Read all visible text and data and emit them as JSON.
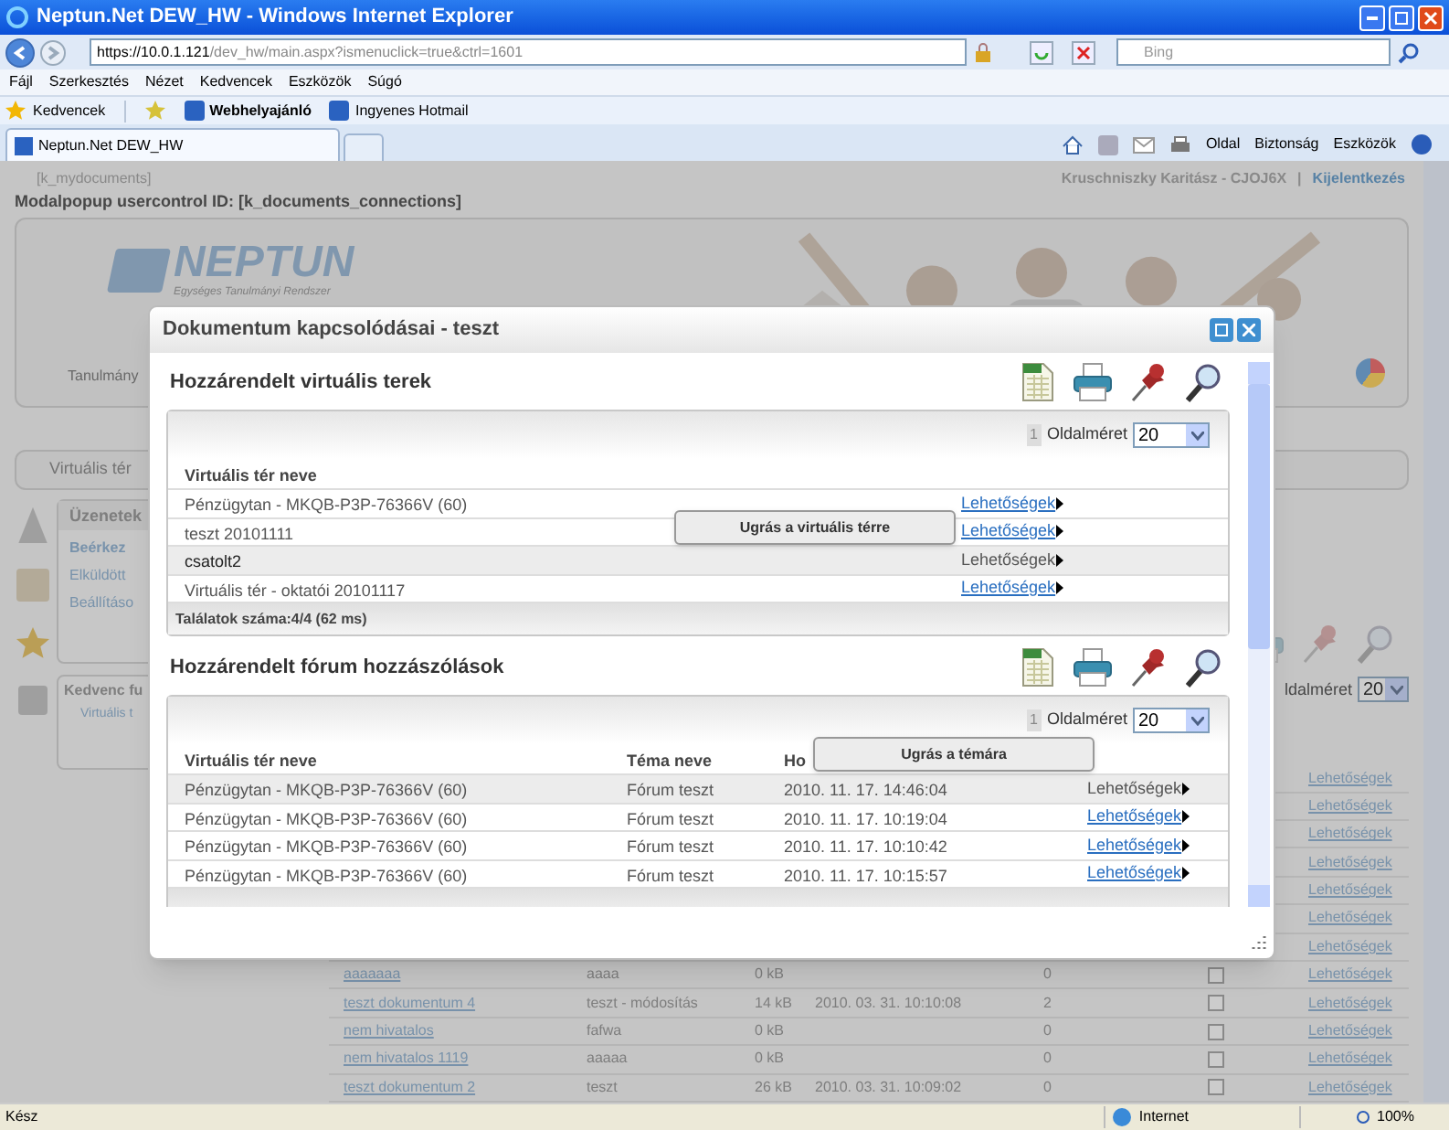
{
  "window": {
    "title": "Neptun.Net DEW_HW - Windows Internet Explorer"
  },
  "address_bar": {
    "url_host": "https://10.0.1.121",
    "url_path": "/dev_hw/main.aspx?ismenuclick=true&ctrl=1601"
  },
  "search": {
    "placeholder": "Bing"
  },
  "menu": [
    "Fájl",
    "Szerkesztés",
    "Nézet",
    "Kedvencek",
    "Eszközök",
    "Súgó"
  ],
  "favorites_bar": {
    "favorites": "Kedvencek",
    "links": [
      {
        "label": "Webhelyajánló",
        "bold": true
      },
      {
        "label": "Ingyenes Hotmail",
        "bold": false
      }
    ]
  },
  "tabs": [
    {
      "label": "Neptun.Net DEW_HW",
      "selected": true
    }
  ],
  "command_bar": [
    "Oldal",
    "Biztonság",
    "Eszközök"
  ],
  "page": {
    "page_id": "[k_mydocuments]",
    "modal_info": "Modalpopup usercontrol ID: [k_documents_connections]",
    "user": "Kruschniszky Karitász - CJOJ6X",
    "separator": "|",
    "logout": "Kijelentkezés",
    "logo": "NEPTUN",
    "logo_subtitle": "Egységes Tanulmányi Rendszer",
    "header_tab": "Tanulmány",
    "nav_tab": "Virtuális tér",
    "messages": {
      "title": "Üzenetek",
      "items": [
        {
          "label": "Beérkez",
          "bold": true
        },
        {
          "label": "Elküldött",
          "bold": false
        },
        {
          "label": "Beállításo",
          "bold": false
        }
      ]
    },
    "favorites": {
      "title": "Kedvenc fu",
      "items": [
        "Virtuális t"
      ]
    },
    "documents": {
      "page_size_label": "ldalméret",
      "page_size": "20",
      "rows": [
        {
          "options": "Lehetőségek"
        },
        {
          "options": "Lehetőségek"
        },
        {
          "options": "Lehetőségek"
        },
        {
          "options": "Lehetőségek"
        },
        {
          "options": "Lehetőségek"
        },
        {
          "options": "Lehetőségek"
        },
        {
          "options": "Lehetőségek"
        },
        {
          "name": "aaaaaaa",
          "description": "aaaa",
          "size": "0 kB",
          "count": "0",
          "checked": false,
          "options": "Lehetőségek"
        },
        {
          "name": "teszt dokumentum 4",
          "description": "teszt - módosítás",
          "size": "14 kB",
          "date": "2010. 03. 31. 10:10:08",
          "count": "2",
          "checked": false,
          "options": "Lehetőségek"
        },
        {
          "name": "nem hivatalos",
          "description": "fafwa",
          "size": "0 kB",
          "count": "0",
          "checked": false,
          "options": "Lehetőségek"
        },
        {
          "name": "nem hivatalos 1119",
          "description": "aaaaa",
          "size": "0 kB",
          "count": "0",
          "checked": false,
          "options": "Lehetőségek"
        },
        {
          "name": "teszt dokumentum 2",
          "description": "teszt",
          "size": "26 kB",
          "date": "2010. 03. 31. 10:09:02",
          "count": "0",
          "checked": false,
          "options": "Lehetőségek"
        }
      ]
    }
  },
  "modal": {
    "title": "Dokumentum kapcsolódásai - teszt",
    "sections": [
      {
        "title": "Hozzárendelt virtuális terek",
        "page": "1",
        "page_size_label": "Oldalméret",
        "page_size": "20",
        "columns": [
          "Virtuális tér neve"
        ],
        "tooltip": "Ugrás a virtuális térre",
        "footer": "Találatok száma:4/4 (62 ms)",
        "rows": [
          {
            "cells": [
              "Pénzügytan - MKQB-P3P-76366V (60)"
            ],
            "options": "Lehetőségek",
            "selected": false
          },
          {
            "cells": [
              "teszt 20101111"
            ],
            "options": "Lehetőségek",
            "selected": false
          },
          {
            "cells": [
              "csatolt2"
            ],
            "options": "Lehetőségek",
            "selected": true
          },
          {
            "cells": [
              "Virtuális tér - oktatói 20101117"
            ],
            "options": "Lehetőségek",
            "selected": false
          }
        ]
      },
      {
        "title": "Hozzárendelt fórum hozzászólások",
        "page": "1",
        "page_size_label": "Oldalméret",
        "page_size": "20",
        "columns": [
          "Virtuális tér neve",
          "Téma neve",
          "Ho"
        ],
        "tooltip": "Ugrás a témára",
        "rows": [
          {
            "cells": [
              "Pénzügytan - MKQB-P3P-76366V (60)",
              "Fórum teszt",
              "2010. 11. 17. 14:46:04"
            ],
            "options": "Lehetőségek",
            "selected": true
          },
          {
            "cells": [
              "Pénzügytan - MKQB-P3P-76366V (60)",
              "Fórum teszt",
              "2010. 11. 17. 10:19:04"
            ],
            "options": "Lehetőségek",
            "selected": false
          },
          {
            "cells": [
              "Pénzügytan - MKQB-P3P-76366V (60)",
              "Fórum teszt",
              "2010. 11. 17. 10:10:42"
            ],
            "options": "Lehetőségek",
            "selected": false
          },
          {
            "cells": [
              "Pénzügytan - MKQB-P3P-76366V (60)",
              "Fórum teszt",
              "2010. 11. 17. 10:15:57"
            ],
            "options": "Lehetőségek",
            "selected": false
          }
        ]
      }
    ]
  },
  "status_bar": {
    "text": "Kész",
    "zone": "Internet",
    "zoom": "100%"
  }
}
